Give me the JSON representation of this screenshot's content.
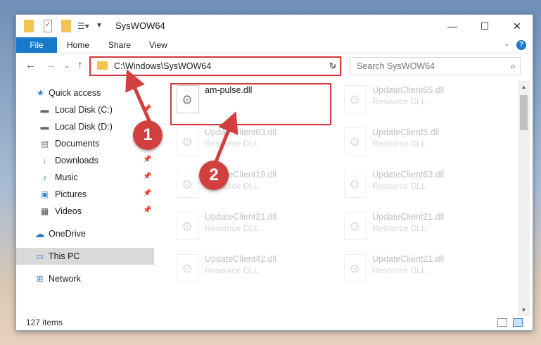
{
  "window": {
    "title": "SysWOW64",
    "controls": {
      "minimize": "—",
      "maximize": "☐",
      "close": "✕"
    }
  },
  "ribbon": {
    "tabs": [
      "File",
      "Home",
      "Share",
      "View"
    ],
    "help_label": "?"
  },
  "address_bar": {
    "path": "C:\\Windows\\SysWOW64"
  },
  "search": {
    "placeholder": "Search SysWOW64"
  },
  "sidebar": {
    "items": [
      {
        "label": "Quick access",
        "icon": "star-icon"
      },
      {
        "label": "Local Disk (C:)",
        "icon": "drive-icon"
      },
      {
        "label": "Local Disk (D:)",
        "icon": "drive-icon"
      },
      {
        "label": "Documents",
        "icon": "documents-icon"
      },
      {
        "label": "Downloads",
        "icon": "download-arrow-icon"
      },
      {
        "label": "Music",
        "icon": "music-note-icon"
      },
      {
        "label": "Pictures",
        "icon": "picture-icon"
      },
      {
        "label": "Videos",
        "icon": "video-icon"
      },
      {
        "label": "OneDrive",
        "icon": "cloud-icon"
      },
      {
        "label": "This PC",
        "icon": "computer-icon"
      },
      {
        "label": "Network",
        "icon": "network-icon"
      }
    ]
  },
  "files": [
    {
      "name": "am-pulse.dll",
      "type": ""
    },
    {
      "name": "UpdateClient65.dll",
      "type": "Resource DLL"
    },
    {
      "name": "UpdateClient63.dll",
      "type": "Resource DLL"
    },
    {
      "name": "UpdateClient5.dll",
      "type": "Resource DLL"
    },
    {
      "name": "UpdateClient19.dll",
      "type": "Resource DLL"
    },
    {
      "name": "UpdateClient63.dll",
      "type": "Resource DLL"
    },
    {
      "name": "UpdateClient21.dll",
      "type": "Resource DLL"
    },
    {
      "name": "UpdateClient21.dll",
      "type": "Resource DLL"
    },
    {
      "name": "UpdateClient42.dll",
      "type": "Resource DLL"
    },
    {
      "name": "UpdateClient21.dll",
      "type": "Resource DLL"
    }
  ],
  "status": {
    "item_count": "127 items"
  },
  "annotations": {
    "step1": "1",
    "step2": "2",
    "highlight_color": "#d33a3a"
  }
}
